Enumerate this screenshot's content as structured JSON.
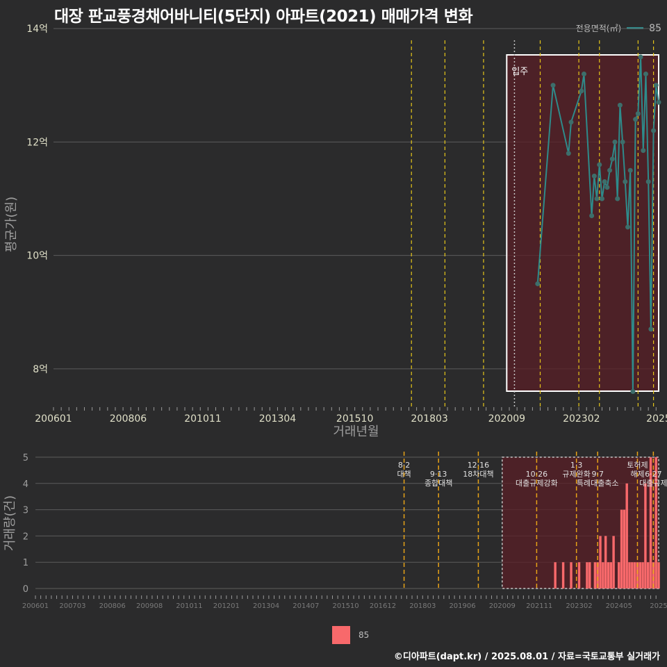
{
  "title": "대장 판교풍경채어바니티(5단지) 아파트(2021) 매매가격 변화",
  "legend_top": {
    "title": "전용면적(㎡)",
    "value": "85"
  },
  "legend_bottom": {
    "value": "85"
  },
  "credit": "©디아파트(dapt.kr) / 2025.08.01 / 자료=국토교통부 실거래가",
  "colors": {
    "background": "#2b2b2c",
    "line": "#2e8b8b",
    "point": "#3d6e6b",
    "bar": "#f8696b",
    "policy": "#e6c619",
    "policy_bottom": "#e8a317",
    "highlight": "#5a1f26"
  },
  "chart_data": [
    {
      "type": "line",
      "xlabel": "거래년월",
      "ylabel": "평균가(원)",
      "ylim": [
        7.3,
        14.1
      ],
      "y_ticks": [
        8,
        10,
        12,
        14
      ],
      "y_tick_labels": [
        "8억",
        "10억",
        "12억",
        "14억"
      ],
      "x_tick_labels": [
        "200601",
        "200806",
        "201011",
        "201304",
        "201510",
        "201803",
        "202009",
        "202302",
        "2025"
      ],
      "policy_lines": [
        "2017.08",
        "2018.09",
        "2019.12",
        "2021.10",
        "2023.01",
        "2023.09",
        "2024.12",
        "2025.06"
      ],
      "move_in": {
        "label": "입주",
        "date": "2020.12",
        "box": [
          "2020.09",
          "2025.08"
        ]
      },
      "series": [
        {
          "name": "85",
          "points": [
            [
              "2021.09",
              9.5
            ],
            [
              "2022.03",
              13.0
            ],
            [
              "2022.09",
              11.8
            ],
            [
              "2022.10",
              12.35
            ],
            [
              "2023.02",
              12.9
            ],
            [
              "2023.03",
              13.2
            ],
            [
              "2023.06",
              10.7
            ],
            [
              "2023.07",
              11.4
            ],
            [
              "2023.08",
              11.0
            ],
            [
              "2023.09",
              11.6
            ],
            [
              "2023.10",
              11.0
            ],
            [
              "2023.11",
              11.3
            ],
            [
              "2023.12",
              11.2
            ],
            [
              "2024.01",
              11.5
            ],
            [
              "2024.02",
              11.7
            ],
            [
              "2024.03",
              12.0
            ],
            [
              "2024.04",
              11.0
            ],
            [
              "2024.05",
              12.65
            ],
            [
              "2024.06",
              12.0
            ],
            [
              "2024.07",
              11.3
            ],
            [
              "2024.08",
              10.5
            ],
            [
              "2024.09",
              11.5
            ],
            [
              "2024.10",
              7.6
            ],
            [
              "2024.11",
              12.4
            ],
            [
              "2024.12",
              12.5
            ],
            [
              "2025.01",
              13.5
            ],
            [
              "2025.02",
              11.85
            ],
            [
              "2025.03",
              13.2
            ],
            [
              "2025.04",
              11.3
            ],
            [
              "2025.05",
              8.7
            ],
            [
              "2025.06",
              12.2
            ],
            [
              "2025.07",
              13.0
            ],
            [
              "2025.08",
              12.7
            ]
          ]
        }
      ]
    },
    {
      "type": "bar",
      "xlabel": "",
      "ylabel": "거래량(건)",
      "ylim": [
        0,
        5
      ],
      "y_ticks": [
        0,
        1,
        2,
        3,
        4,
        5
      ],
      "x_tick_labels": [
        "200601",
        "200703",
        "200806",
        "200908",
        "201011",
        "201201",
        "201304",
        "201407",
        "201510",
        "201612",
        "201803",
        "201906",
        "202009",
        "202111",
        "202302",
        "202405",
        "2025"
      ],
      "policy_annotations": [
        {
          "date": "2017.08",
          "label": "8·2 대책"
        },
        {
          "date": "2018.09",
          "label": "9·13 종합대책"
        },
        {
          "date": "2019.12",
          "label": "12·16 18차대책"
        },
        {
          "date": "2021.10",
          "label": "10·26 대출규제강화"
        },
        {
          "date": "2023.01",
          "label": "1·3 규제완화"
        },
        {
          "date": "2023.09",
          "label": "9·7 특례대출축소"
        },
        {
          "date": "2024.12",
          "label": "토허제 해제"
        },
        {
          "date": "2025.06",
          "label": "6·27 대출규제"
        }
      ],
      "series": [
        {
          "name": "85",
          "bars": [
            [
              "2022.05",
              1
            ],
            [
              "2022.08",
              1
            ],
            [
              "2022.11",
              1
            ],
            [
              "2023.02",
              1
            ],
            [
              "2023.05",
              1
            ],
            [
              "2023.06",
              1
            ],
            [
              "2023.08",
              1
            ],
            [
              "2023.09",
              1
            ],
            [
              "2023.10",
              2
            ],
            [
              "2023.11",
              1
            ],
            [
              "2023.12",
              2
            ],
            [
              "2024.01",
              1
            ],
            [
              "2024.02",
              1
            ],
            [
              "2024.03",
              2
            ],
            [
              "2024.05",
              1
            ],
            [
              "2024.06",
              3
            ],
            [
              "2024.07",
              3
            ],
            [
              "2024.08",
              4
            ],
            [
              "2024.09",
              1
            ],
            [
              "2024.10",
              1
            ],
            [
              "2024.11",
              1
            ],
            [
              "2024.12",
              1
            ],
            [
              "2025.01",
              1
            ],
            [
              "2025.02",
              1
            ],
            [
              "2025.03",
              4
            ],
            [
              "2025.04",
              1
            ],
            [
              "2025.05",
              5
            ],
            [
              "2025.06",
              1
            ],
            [
              "2025.07",
              5
            ],
            [
              "2025.08",
              1
            ]
          ]
        }
      ]
    }
  ]
}
